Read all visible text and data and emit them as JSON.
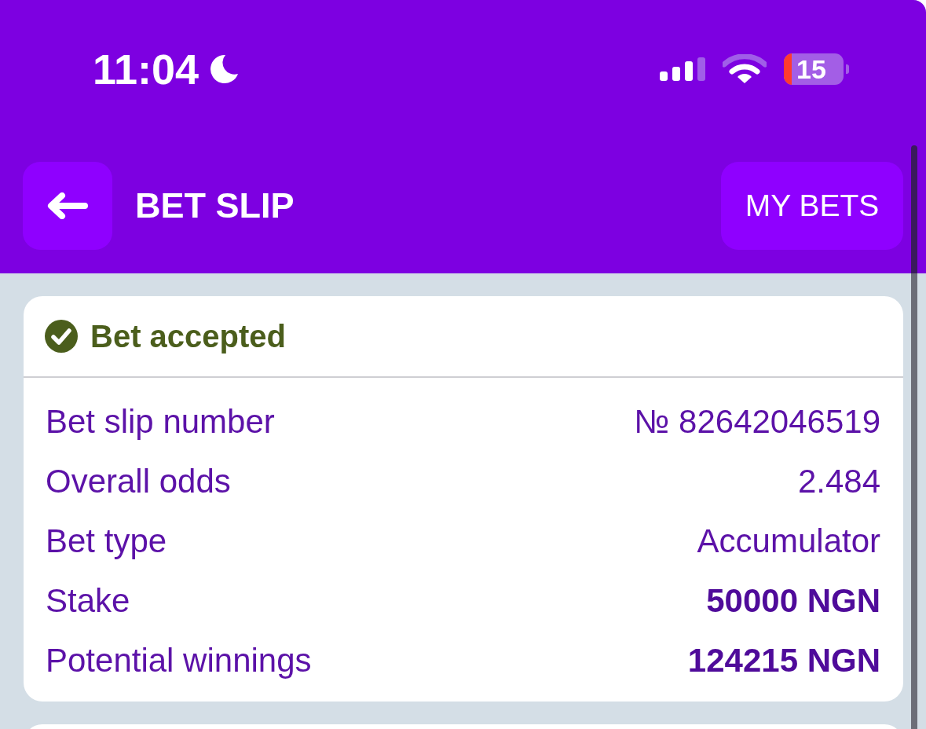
{
  "status_bar": {
    "time": "11:04",
    "battery": "15"
  },
  "header": {
    "title": "BET SLIP",
    "action_button": "MY BETS"
  },
  "receipt": {
    "status": "Bet accepted",
    "rows": [
      {
        "label": "Bet slip number",
        "value": "№ 82642046519",
        "bold": false
      },
      {
        "label": "Overall odds",
        "value": "2.484",
        "bold": false
      },
      {
        "label": "Bet type",
        "value": "Accumulator",
        "bold": false
      },
      {
        "label": "Stake",
        "value": "50000 NGN",
        "bold": true
      },
      {
        "label": "Potential winnings",
        "value": "124215 NGN",
        "bold": true
      }
    ]
  }
}
